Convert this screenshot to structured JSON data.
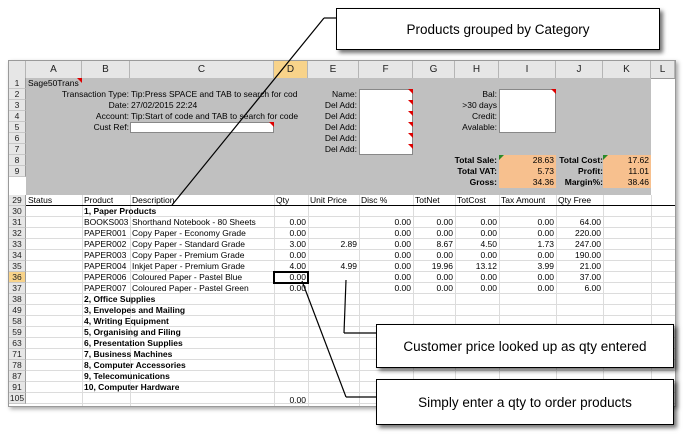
{
  "callouts": {
    "top": "Products grouped by Category",
    "middle": "Customer price looked up as qty entered",
    "bottom": "Simply enter a qty to order products"
  },
  "columns": [
    "A",
    "B",
    "C",
    "D",
    "E",
    "F",
    "G",
    "H",
    "I",
    "J",
    "K",
    "L"
  ],
  "selected_column": "D",
  "selected_row": "36",
  "row_numbers": [
    "1",
    "2",
    "3",
    "4",
    "5",
    "6",
    "7",
    "8",
    "9",
    "29",
    "30",
    "31",
    "32",
    "33",
    "34",
    "35",
    "36",
    "37",
    "38",
    "49",
    "58",
    "59",
    "63",
    "71",
    "78",
    "87",
    "91",
    "105"
  ],
  "header": {
    "app_label": "Sage50Trans",
    "transaction_type_label": "Transaction Type:",
    "transaction_type_value": "Tip:Press SPACE and TAB to search for cod",
    "date_label": "Date:",
    "date_value": "27/02/2015 22:24",
    "account_label": "Account:",
    "account_value": "Tip:Start of code and TAB to search for code",
    "custref_label": "Cust Ref:",
    "name_label": "Name:",
    "del_add_label": "Del Add:",
    "bal_label": "Bal:",
    "days30_label": ">30 days",
    "credit_label": "Credit:",
    "avalable_label": "Avalable:"
  },
  "totals": {
    "total_sale_label": "Total Sale:",
    "total_sale": "28.63",
    "total_vat_label": "Total VAT:",
    "total_vat": "5.73",
    "gross_label": "Gross:",
    "gross": "34.36",
    "total_cost_label": "Total Cost:",
    "total_cost": "17.62",
    "profit_label": "Profit:",
    "profit": "11.01",
    "margin_label": "Margin%:",
    "margin": "38.46"
  },
  "table_headers": {
    "status": "Status",
    "product": "Product",
    "description": "Description",
    "qty": "Qty",
    "unit_price": "Unit Price",
    "disc": "Disc %",
    "totnet": "TotNet",
    "totcost": "TotCost",
    "tax_amount": "Tax Amount",
    "qty_free": "Qty Free"
  },
  "categories": {
    "c1": "1, Paper Products",
    "c2": "2, Office Supplies",
    "c3": "3, Envelopes and Mailing",
    "c4": "4, Writing Equipment",
    "c5": "5, Organising and Filing",
    "c6": "6, Presentation Supplies",
    "c7": "7, Business Machines",
    "c8": "8, Computer Accessories",
    "c9": "9, Telecomunications",
    "c10": "10, Computer Hardware"
  },
  "products": [
    {
      "code": "BOOKS003",
      "desc": "Shorthand Notebook - 80 Sheets",
      "qty": "0.00",
      "price": "",
      "disc": "0.00",
      "net": "0.00",
      "cost": "0.00",
      "tax": "0.00",
      "free": "64.00"
    },
    {
      "code": "PAPER001",
      "desc": "Copy Paper - Economy Grade",
      "qty": "0.00",
      "price": "",
      "disc": "0.00",
      "net": "0.00",
      "cost": "0.00",
      "tax": "0.00",
      "free": "220.00"
    },
    {
      "code": "PAPER002",
      "desc": "Copy Paper - Standard Grade",
      "qty": "3.00",
      "price": "2.89",
      "disc": "0.00",
      "net": "8.67",
      "cost": "4.50",
      "tax": "1.73",
      "free": "247.00"
    },
    {
      "code": "PAPER003",
      "desc": "Copy Paper - Premium Grade",
      "qty": "0.00",
      "price": "",
      "disc": "0.00",
      "net": "0.00",
      "cost": "0.00",
      "tax": "0.00",
      "free": "190.00"
    },
    {
      "code": "PAPER004",
      "desc": "Inkjet Paper - Premium Grade",
      "qty": "4.00",
      "price": "4.99",
      "disc": "0.00",
      "net": "19.96",
      "cost": "13.12",
      "tax": "3.99",
      "free": "21.00"
    },
    {
      "code": "PAPER006",
      "desc": "Coloured Paper - Pastel Blue",
      "qty": "0.00",
      "price": "",
      "disc": "0.00",
      "net": "0.00",
      "cost": "0.00",
      "tax": "0.00",
      "free": "37.00"
    },
    {
      "code": "PAPER007",
      "desc": "Coloured Paper - Pastel Green",
      "qty": "0.00",
      "price": "",
      "disc": "0.00",
      "net": "0.00",
      "cost": "0.00",
      "tax": "0.00",
      "free": "6.00"
    }
  ],
  "last_qty": "0.00"
}
